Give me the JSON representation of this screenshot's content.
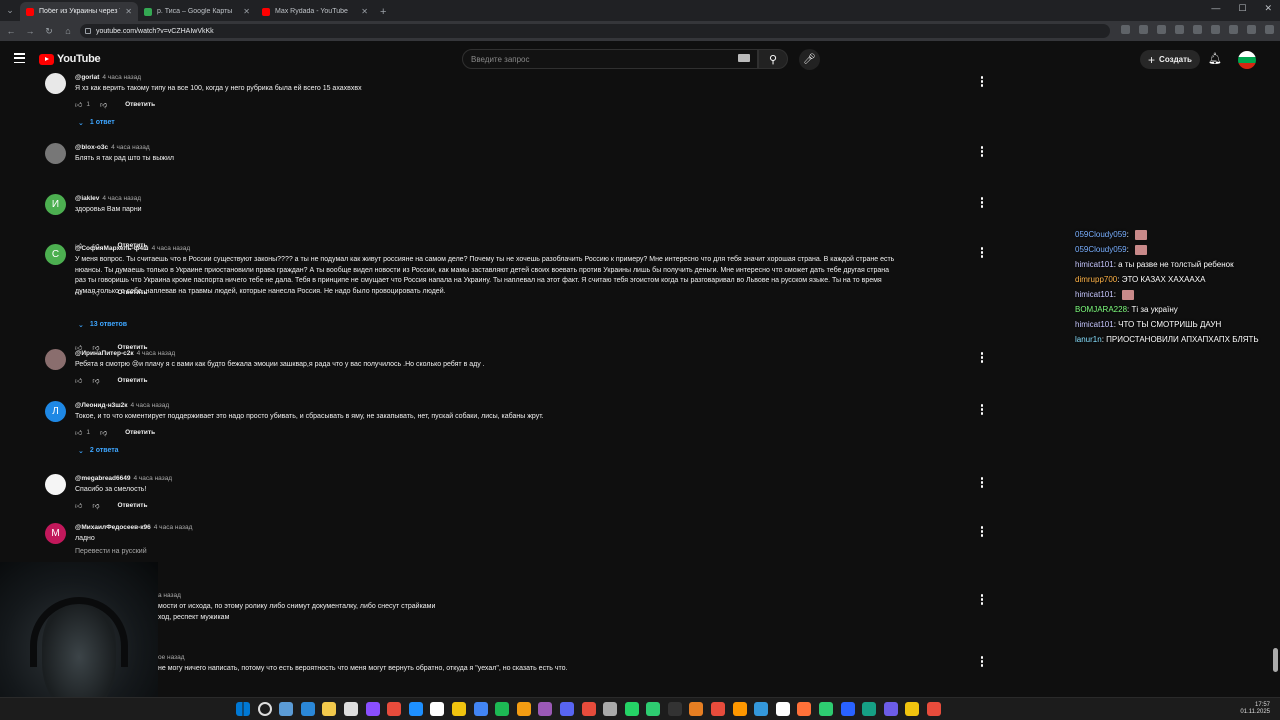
{
  "browser": {
    "tabs": [
      {
        "title": "Побег из Украины через Ти",
        "active": true,
        "favicon_color": "#ff0000"
      },
      {
        "title": "р. Тиса – Google Карты",
        "active": false,
        "favicon_color": "#34a853"
      },
      {
        "title": "Max Rydada - YouTube",
        "active": false,
        "favicon_color": "#ff0000"
      }
    ],
    "new_tab_label": "+",
    "url": "youtube.com/watch?v=vCZHAIwVkKk"
  },
  "youtube": {
    "logo_text": "YouTube",
    "search_placeholder": "Введите запрос",
    "create_label": "Создать"
  },
  "comments": [
    {
      "author": "@gorlat",
      "time": "4 часа назад",
      "avatar_color": "#e8e8e8",
      "avatar_letter": "",
      "lines": [
        "Я хз как верить такому типу на все 100, когда у него рубрика была ей всего 15 ахахвхвх"
      ],
      "likes": "1",
      "reply_label": "Ответить",
      "replies": "1 ответ"
    },
    {
      "author": "@blox-o3c",
      "time": "4 часа назад",
      "avatar_color": "#777777",
      "avatar_letter": "",
      "lines": [
        "Блять я так рад што ты выжил"
      ],
      "likes": "",
      "reply_label": "Ответить",
      "replies": ""
    },
    {
      "author": "@iaklev",
      "time": "4 часа назад",
      "avatar_color": "#4caf50",
      "avatar_letter": "И",
      "lines": [
        "здоровья Вам парни"
      ],
      "likes": "",
      "reply_label": "Ответить",
      "replies": ""
    },
    {
      "author": "@СофияМархель-ф4ш",
      "time": "4 часа назад",
      "avatar_color": "#4caf50",
      "avatar_letter": "С",
      "lines": [
        "У меня вопрос. Ты считаешь что в России существуют законы???? а ты не подумал как живут россияне на самом деле? Почему ты не хочешь разоблачить Россию к примеру? Мне интересно что для тебя значит хорошая страна. В каждой стране есть",
        "нюансы. Ты думаешь только в Украине приостановили права граждан? А ты вообще видел новости из России, как мамы заставляют детей своих воевать против Украины лишь бы получить деньги. Мне интересно что сможет дать тебе другая страна",
        "раз ты говоришь что Украина кроме паспорта ничего тебе не дала. Тебя в принципе не смущает что Россия напала на Украину. Ты наплевал на этот факт. Я считаю тебя эгоистом когда ты разговаривал во Львове на русском языке. Ты на то время",
        "думал только о себе, наплевав на травмы людей, которые нанесла Россия. Не надо было провоцировать людей."
      ],
      "likes": "",
      "reply_label": "Ответить",
      "replies": "13 ответов"
    },
    {
      "author": "@ИринаПитер-с2к",
      "time": "4 часа назад",
      "avatar_color": "#8a6e6e",
      "avatar_letter": "",
      "lines": [
        "Ребята я смотрю 😢и плачу я с вами как будто бежала эмоции зашквар,я рада что у вас получилось .Но сколько ребят в аду ."
      ],
      "likes": "",
      "reply_label": "Ответить",
      "replies": ""
    },
    {
      "author": "@Леонид-н3ш2к",
      "time": "4 часа назад",
      "avatar_color": "#1e88e5",
      "avatar_letter": "Л",
      "lines": [
        "Токое, и то что коментирует поддерживает это надо просто убивать, и сбрасывать в яму, не закапывать, нет, пускай собаки, лисы, кабаны жрут."
      ],
      "likes": "1",
      "reply_label": "Ответить",
      "replies": "2 ответа"
    },
    {
      "author": "@megabread6649",
      "time": "4 часа назад",
      "avatar_color": "#f5f5f5",
      "avatar_letter": "",
      "lines": [
        "Спасибо за смелость!"
      ],
      "likes": "",
      "reply_label": "Ответить",
      "replies": ""
    },
    {
      "author": "@МихаилФедосеев-к96",
      "time": "4 часа назад",
      "avatar_color": "#c2185b",
      "avatar_letter": "М",
      "lines": [
        "ладно"
      ],
      "likes": "",
      "reply_label": "",
      "replies": "",
      "translate": "Перевести на русский"
    },
    {
      "author": "",
      "time": "а назад",
      "avatar_color": "",
      "avatar_letter": "",
      "lines": [
        "мости от исхода, по этому ролику либо снимут документалку, либо снесут страйками",
        "ход, респект мужикам"
      ],
      "likes": "",
      "reply_label": "",
      "replies": ""
    },
    {
      "author": "",
      "time": "ое назад",
      "avatar_color": "",
      "avatar_letter": "",
      "lines": [
        "не могу ничего написать, потому что есть вероятность что меня могут вернуть обратно, откуда я \"уехал\", но сказать есть что."
      ],
      "likes": "",
      "reply_label": "",
      "replies": ""
    }
  ],
  "chat": [
    {
      "user": "059Cloudy059",
      "color": "#7ab0ff",
      "message": "",
      "emote": true
    },
    {
      "user": "059Cloudy059",
      "color": "#7ab0ff",
      "message": "",
      "emote": true
    },
    {
      "user": "himicat101",
      "color": "#c8c8ff",
      "message": "а ты разве не толстый ребенок",
      "emote": false
    },
    {
      "user": "dimrupp700",
      "color": "#ffb347",
      "message": "ЭТО КАЗАХ ХАХААХА",
      "emote": false
    },
    {
      "user": "himicat101",
      "color": "#c8c8ff",
      "message": "",
      "emote": true
    },
    {
      "user": "BOMJARA228",
      "color": "#7fff7f",
      "message": "Ті за україну",
      "emote": false
    },
    {
      "user": "himicat101",
      "color": "#c8c8ff",
      "message": "ЧТО ТЫ СМОТРИШЬ ДАУН",
      "emote": false
    },
    {
      "user": "lanur1n",
      "color": "#88e0ff",
      "message": "ПРИОСТАНОВИЛИ АПХАПХАПХ БЛЯТЬ",
      "emote": false
    }
  ],
  "taskbar": {
    "time": "17:57",
    "date": "01.11.2025",
    "icon_colors": [
      "#0078d4",
      "#dddddd",
      "#5b9bd5",
      "#2b88d8",
      "#f2c94c",
      "#dddddd",
      "#8a4fff",
      "#e74c3c",
      "#1e90ff",
      "#ffffff",
      "#f1c40f",
      "#4285f4",
      "#1db954",
      "#f39c12",
      "#9b59b6",
      "#5865f2",
      "#e74c3c",
      "#aaaaaa",
      "#25d366",
      "#2ecc71",
      "#333333",
      "#e67e22",
      "#e74c3c",
      "#ff9800",
      "#3498db",
      "#ffffff",
      "#ff7139",
      "#2ecc71",
      "#2962ff",
      "#16a085",
      "#6c5ce7",
      "#f1c40f",
      "#e74c3c"
    ]
  }
}
